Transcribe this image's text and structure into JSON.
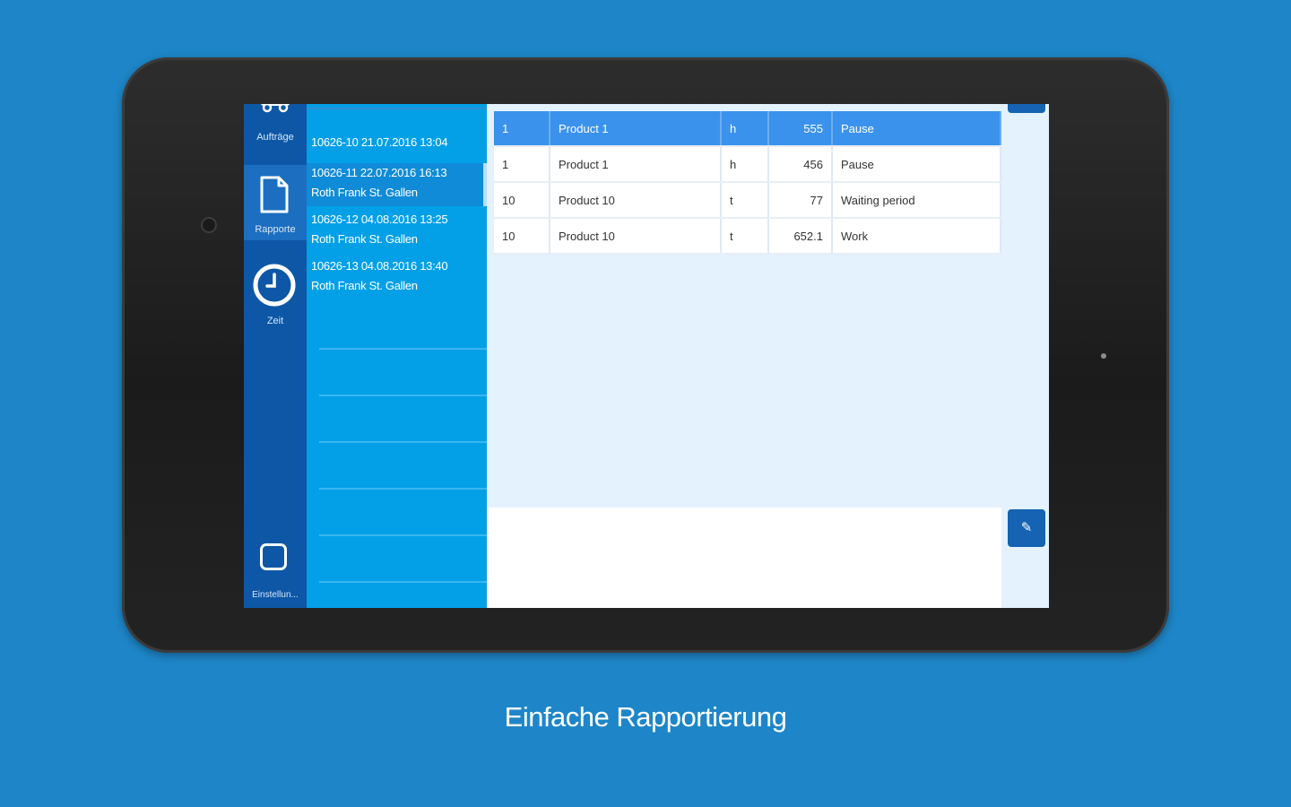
{
  "nav": {
    "items": [
      {
        "label": "Aufträge",
        "icon": "car-icon"
      },
      {
        "label": "Rapporte",
        "icon": "document-icon"
      },
      {
        "label": "Zeit",
        "icon": "clock-icon"
      },
      {
        "label": "Einstellun...",
        "icon": "settings-icon"
      }
    ],
    "active": "Rapporte"
  },
  "reports": [
    {
      "line1": "10626-10 21.07.2016 13:04",
      "line2": ""
    },
    {
      "line1": "10626-11 22.07.2016 16:13",
      "line2": "Roth Frank St. Gallen"
    },
    {
      "line1": "10626-12 04.08.2016 13:25",
      "line2": "Roth Frank St. Gallen"
    },
    {
      "line1": "10626-13 04.08.2016 13:40",
      "line2": "Roth Frank St. Gallen"
    }
  ],
  "table": {
    "rows": [
      {
        "qty": "1",
        "product": "Product 1",
        "unit": "h",
        "value": "555",
        "type": "Pause"
      },
      {
        "qty": "1",
        "product": "Product 1",
        "unit": "h",
        "value": "456",
        "type": "Pause"
      },
      {
        "qty": "10",
        "product": "Product 10",
        "unit": "t",
        "value": "77",
        "type": "Waiting period"
      },
      {
        "qty": "10",
        "product": "Product 10",
        "unit": "t",
        "value": "652.1",
        "type": "Work"
      }
    ]
  },
  "edit_button": {
    "icon": "pencil-icon",
    "glyph": "✎"
  },
  "caption": "Einfache Rapportierung",
  "colors": {
    "background": "#1e86c8",
    "nav": "#0d57a6",
    "list": "#03a0e8",
    "selected_row": "#3a92ec",
    "button": "#1563b2"
  }
}
